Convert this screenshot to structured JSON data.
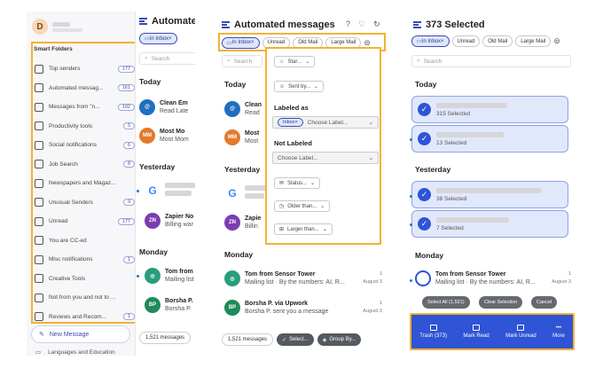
{
  "panel1": {
    "avatar_letter": "D",
    "smart_folders": "Smart Folders",
    "items": [
      {
        "label": "Top senders",
        "count": "177"
      },
      {
        "label": "Automated messag...",
        "count": "161"
      },
      {
        "label": "Messages from \"n...",
        "count": "102"
      },
      {
        "label": "Productivity tools",
        "count": "5"
      },
      {
        "label": "Social notifications",
        "count": "6"
      },
      {
        "label": "Job Search",
        "count": "8"
      },
      {
        "label": "Newspapers and Magaz...",
        "count": ""
      },
      {
        "label": "Unusual Senders",
        "count": "9"
      },
      {
        "label": "Unread",
        "count": "177"
      },
      {
        "label": "You are CC-ed",
        "count": ""
      },
      {
        "label": "Misc notifications",
        "count": "1"
      },
      {
        "label": "Creative Tools",
        "count": ""
      },
      {
        "label": "Not from you and not to ...",
        "count": ""
      },
      {
        "label": "Reviews and Recom...",
        "count": "1"
      }
    ],
    "new_message": "New Message",
    "languages": "Languages and Education",
    "list_title": "Automated",
    "inbox_chip": "In Inbox",
    "search": "Search",
    "today": "Today",
    "yesterday": "Yesterday",
    "monday": "Monday",
    "m1": {
      "from": "Clean Em",
      "sub": "Read Late"
    },
    "m2": {
      "from": "Most Mo",
      "sub": "Most Mom",
      "initials": "MM"
    },
    "m4": {
      "from": "Zapier No",
      "sub": "Billing war",
      "initials": "ZN"
    },
    "m5": {
      "from": "Tom from",
      "sub": "Mailing list"
    },
    "m6": {
      "from": "Borsha P.",
      "sub": "Borsha P.",
      "initials": "BP"
    },
    "count_pill": "1,521 messages"
  },
  "panel2": {
    "title": "Automated messages",
    "chips": [
      "In Inbox",
      "Unread",
      "Old Mail",
      "Large Mail"
    ],
    "search": "Search",
    "today": "Today",
    "yesterday": "Yesterday",
    "monday": "Monday",
    "m1": {
      "from": "Clean",
      "sub": "Read"
    },
    "m2": {
      "from": "Most",
      "sub": "Most",
      "initials": "MM"
    },
    "m4": {
      "from": "Zapie",
      "sub": "Billin",
      "initials": "ZN"
    },
    "m5": {
      "from": "Tom from Sensor Tower",
      "sub": "Mailing list · By the numbers: AI, R...",
      "date": "August 3",
      "num": "1"
    },
    "m6": {
      "from": "Borsha P. via Upwork",
      "sub": "Borsha P. sent you a message",
      "date": "August 3",
      "num": "1"
    },
    "filter": {
      "starred": "Star...",
      "sent_by": "Sent by...",
      "labeled_as": "Labeled as",
      "inbox_tag": "Inbox",
      "choose_label": "Choose Label...",
      "not_labeled": "Not Labeled",
      "choose_label2": "Choose Label...",
      "status": "Status...",
      "older_than": "Older than...",
      "larger_than": "Larger than..."
    },
    "bottom": {
      "count": "1,521 messages",
      "select": "Select...",
      "group": "Group By..."
    }
  },
  "panel3": {
    "title": "373 Selected",
    "chips": [
      "In Inbox",
      "Unread",
      "Old Mail",
      "Large Mail"
    ],
    "search": "Search",
    "today": "Today",
    "yesterday": "Yesterday",
    "monday": "Monday",
    "sel": [
      "315 Selected",
      "13 Selected",
      "38 Selected",
      "7 Selected"
    ],
    "m5": {
      "from": "Tom from Sensor Tower",
      "sub": "Mailing list · By the numbers: AI, R...",
      "date": "August 3",
      "num": "1"
    },
    "m6": {
      "num": "1",
      "date": "August 3"
    },
    "buttons": {
      "select_all": "Select All (1,521)",
      "clear": "Clear Selection",
      "cancel": "Cancel"
    },
    "actions": [
      "Trash (373)",
      "Mark Read",
      "Mark Unread",
      "More"
    ]
  },
  "colors": {
    "accent": "#2f54d6",
    "highlight": "#f2b233"
  }
}
